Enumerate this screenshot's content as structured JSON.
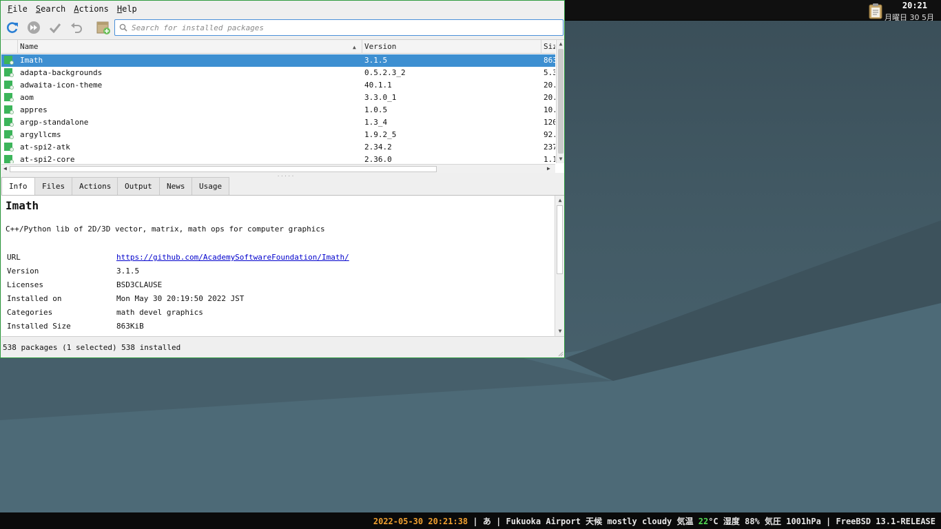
{
  "colors": {
    "accent": "#3d8fd1",
    "window_border": "#2e9b3e",
    "date_highlight": "#f0a030",
    "temp_highlight": "#55dd55"
  },
  "menubar": {
    "items": [
      "File",
      "Search",
      "Actions",
      "Help"
    ]
  },
  "toolbar": {
    "buttons": [
      "refresh-icon",
      "run-all-icon",
      "apply-check-icon",
      "undo-icon",
      "package-add-icon"
    ],
    "search": {
      "placeholder": "Search for installed packages",
      "value": ""
    }
  },
  "package_list": {
    "columns": {
      "name": "Name",
      "version": "Version",
      "size": "Siz"
    },
    "sort": "name-ascending",
    "rows": [
      {
        "name": "Imath",
        "version": "3.1.5",
        "size": "863",
        "selected": true
      },
      {
        "name": "adapta-backgrounds",
        "version": "0.5.2.3_2",
        "size": "5.3"
      },
      {
        "name": "adwaita-icon-theme",
        "version": "40.1.1",
        "size": "20."
      },
      {
        "name": "aom",
        "version": "3.3.0_1",
        "size": "20."
      },
      {
        "name": "appres",
        "version": "1.0.5",
        "size": "10."
      },
      {
        "name": "argp-standalone",
        "version": "1.3_4",
        "size": "120"
      },
      {
        "name": "argyllcms",
        "version": "1.9.2_5",
        "size": "92."
      },
      {
        "name": "at-spi2-atk",
        "version": "2.34.2",
        "size": "237"
      },
      {
        "name": "at-spi2-core",
        "version": "2.36.0",
        "size": "1.1"
      }
    ]
  },
  "tabs": [
    {
      "label": "Info",
      "active": true
    },
    {
      "label": "Files"
    },
    {
      "label": "Actions"
    },
    {
      "label": "Output"
    },
    {
      "label": "News"
    },
    {
      "label": "Usage"
    }
  ],
  "info": {
    "title": "Imath",
    "description": "C++/Python lib of 2D/3D vector, matrix, math ops for computer graphics",
    "fields": [
      {
        "key": "URL",
        "value": "https://github.com/AcademySoftwareFoundation/Imath/",
        "link": true
      },
      {
        "key": "Version",
        "value": "3.1.5"
      },
      {
        "key": "Licenses",
        "value": "BSD3CLAUSE"
      },
      {
        "key": "Installed on",
        "value": "Mon May 30 20:19:50 2022 JST"
      },
      {
        "key": "Categories",
        "value": "math devel graphics"
      },
      {
        "key": "Installed Size",
        "value": "863KiB"
      }
    ]
  },
  "statusbar": {
    "text": "538 packages (1 selected)  538 installed"
  },
  "top_panel": {
    "time": "20:21",
    "date": "月曜日 30 5月",
    "icon": "clipboard-icon"
  },
  "bottom_panel": {
    "datetime": "2022-05-30 20:21:38",
    "sep1": " | ",
    "input_method": "あ",
    "sep2": " | ",
    "weather_prefix": "Fukuoka Airport 天候 mostly cloudy  気温 ",
    "temperature": "22",
    "weather_suffix": "°C 湿度 88% 気圧 1001hPa",
    "sep3": " | ",
    "os": "FreeBSD 13.1-RELEASE"
  }
}
